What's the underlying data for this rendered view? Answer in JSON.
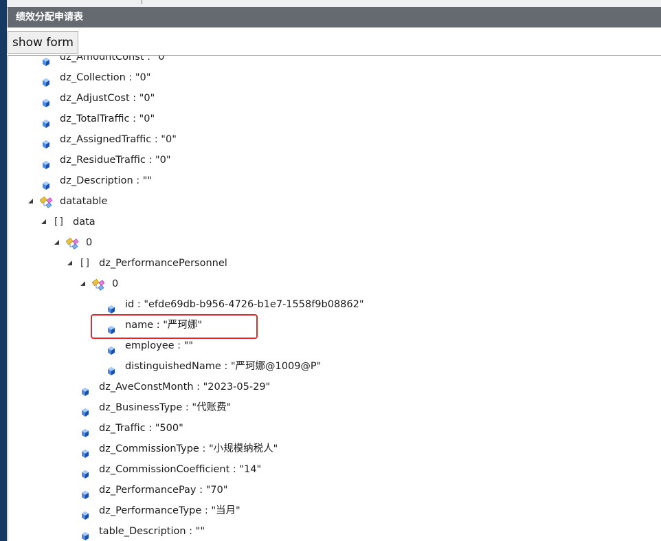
{
  "header": {
    "title": "绩效分配申请表"
  },
  "toolbar": {
    "show_form_label": "show form"
  },
  "colors": {
    "header_bg": "#646a70",
    "highlight": "#e8262b",
    "left_strip": "#173a63"
  },
  "tree": [
    {
      "label": "dz_AmountConst : \"0\""
    },
    {
      "label": "dz_Collection : \"0\""
    },
    {
      "label": "dz_AdjustCost : \"0\""
    },
    {
      "label": "dz_TotalTraffic : \"0\""
    },
    {
      "label": "dz_AssignedTraffic : \"0\""
    },
    {
      "label": "dz_ResidueTraffic : \"0\""
    },
    {
      "label": "dz_Description : \"\""
    },
    {
      "label": "datatable",
      "type": "object",
      "children": [
        {
          "label": "data",
          "type": "array",
          "children": [
            {
              "label": "0",
              "type": "object",
              "children": [
                {
                  "label": "dz_PerformancePersonnel",
                  "type": "array",
                  "children": [
                    {
                      "label": "0",
                      "type": "object",
                      "children": [
                        {
                          "label": "id : \"efde69db-b956-4726-b1e7-1558f9b08862\""
                        },
                        {
                          "label": "name : \"严珂娜\"",
                          "highlighted": true
                        },
                        {
                          "label": "employee : \"\""
                        },
                        {
                          "label": "distinguishedName : \"严珂娜@1009@P\""
                        }
                      ]
                    }
                  ]
                },
                {
                  "label": "dz_AveConstMonth : \"2023-05-29\""
                },
                {
                  "label": "dz_BusinessType : \"代账费\""
                },
                {
                  "label": "dz_Traffic : \"500\""
                },
                {
                  "label": "dz_CommissionType : \"小规模纳税人\""
                },
                {
                  "label": "dz_CommissionCoefficient : \"14\""
                },
                {
                  "label": "dz_PerformancePay : \"70\""
                },
                {
                  "label": "dz_PerformanceType : \"当月\""
                },
                {
                  "label": "table_Description : \"\""
                }
              ]
            }
          ]
        }
      ]
    }
  ]
}
